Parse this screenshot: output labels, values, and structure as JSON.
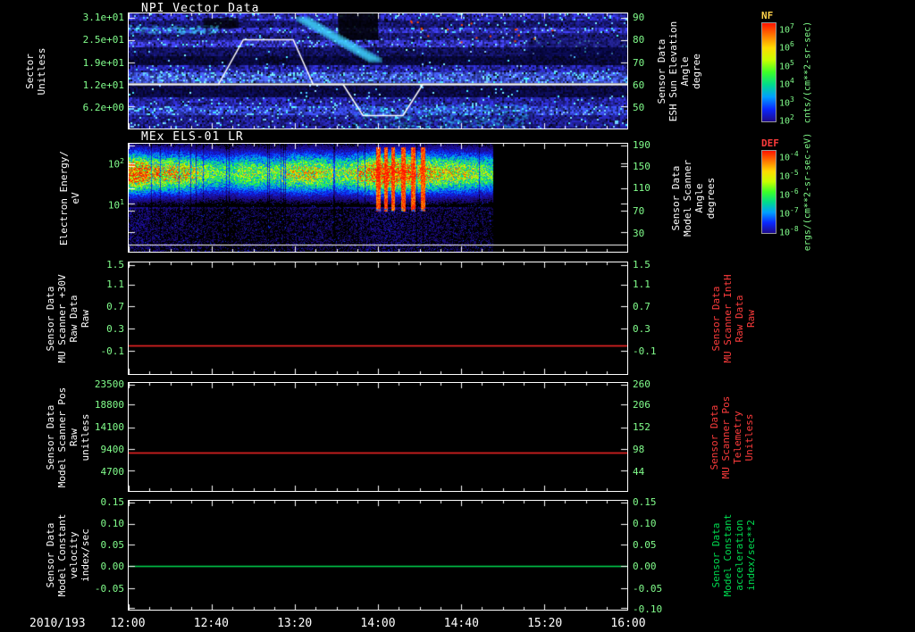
{
  "colors": {
    "background": "#000000",
    "tick_label": "#82ff8c",
    "axis": "#ffffff",
    "red_series": "#ff2828",
    "green_series": "#00dc50"
  },
  "xaxis": {
    "date_label": "2010/193",
    "ticks": [
      "12:00",
      "12:40",
      "13:20",
      "14:00",
      "14:40",
      "15:20",
      "16:00"
    ]
  },
  "chart_data": [
    {
      "type": "heatmap",
      "title": "NPI Vector Data",
      "ylabel_lines": [
        "Sector",
        "Unitless"
      ],
      "yticks": [
        {
          "label": "3.1e+01",
          "f": 0.035
        },
        {
          "label": "2.5e+01",
          "f": 0.23
        },
        {
          "label": "1.9e+01",
          "f": 0.425
        },
        {
          "label": "1.2e+01",
          "f": 0.615
        },
        {
          "label": "6.2e+00",
          "f": 0.81
        }
      ],
      "y2label_lines": [
        "Sensor Data",
        "ESH Sun Elevation",
        "Angle",
        "degree"
      ],
      "y2label_color": "#ffffff",
      "y2ticks": [
        {
          "label": "90",
          "f": 0.035
        },
        {
          "label": "80",
          "f": 0.23
        },
        {
          "label": "70",
          "f": 0.425
        },
        {
          "label": "60",
          "f": 0.615
        },
        {
          "label": "50",
          "f": 0.81
        }
      ],
      "overlay_line": {
        "name": "ESH Sun Elevation Angle",
        "units": "degrees",
        "color": "#ffffff",
        "baseline_deg": 60,
        "points_frac_deg": [
          [
            0,
            60
          ],
          [
            0.18,
            60
          ],
          [
            0.23,
            80
          ],
          [
            0.33,
            80
          ],
          [
            0.37,
            60
          ],
          [
            0.43,
            60
          ],
          [
            0.47,
            46
          ],
          [
            0.55,
            46
          ],
          [
            0.59,
            60
          ],
          [
            1,
            60
          ]
        ],
        "deg_top": 90,
        "f_top": 0.035,
        "deg_bot": 50,
        "f_bot": 0.81
      },
      "colorbar": {
        "title": "NF",
        "title_color": "#ffd24a",
        "units": "cnts/(cm**2-sr-sec)",
        "ticks": [
          "10^7",
          "10^6",
          "10^5",
          "10^4",
          "10^3",
          "10^2"
        ]
      },
      "bands": [
        {
          "f0": 0.0,
          "f1": 0.06,
          "base": [
            40,
            40,
            170
          ],
          "bright": 0.06
        },
        {
          "f0": 0.06,
          "f1": 0.12,
          "base": [
            22,
            22,
            110
          ],
          "bright": 0.02
        },
        {
          "f0": 0.12,
          "f1": 0.17,
          "base": [
            48,
            48,
            190
          ],
          "bright": 0.1
        },
        {
          "f0": 0.17,
          "f1": 0.23,
          "base": [
            26,
            26,
            120
          ],
          "bright": 0.03
        },
        {
          "f0": 0.23,
          "f1": 0.29,
          "base": [
            52,
            52,
            195
          ],
          "bright": 0.08
        },
        {
          "f0": 0.29,
          "f1": 0.37,
          "base": [
            18,
            18,
            95
          ],
          "bright": 0.02
        },
        {
          "f0": 0.37,
          "f1": 0.44,
          "base": [
            8,
            8,
            60
          ],
          "bright": 0.01
        },
        {
          "f0": 0.44,
          "f1": 0.5,
          "base": [
            36,
            36,
            160
          ],
          "bright": 0.05
        },
        {
          "f0": 0.5,
          "f1": 0.6,
          "base": [
            60,
            80,
            215
          ],
          "bright": 0.15
        },
        {
          "f0": 0.62,
          "f1": 0.72,
          "base": [
            10,
            10,
            70
          ],
          "bright": 0.02
        },
        {
          "f0": 0.72,
          "f1": 0.8,
          "base": [
            36,
            36,
            160
          ],
          "bright": 0.05
        },
        {
          "f0": 0.8,
          "f1": 0.88,
          "base": [
            48,
            62,
            200
          ],
          "bright": 0.12
        },
        {
          "f0": 0.88,
          "f1": 1.0,
          "base": [
            30,
            30,
            140
          ],
          "bright": 0.05
        }
      ],
      "features": [
        {
          "type": "rect",
          "x0": 0.42,
          "x1": 0.5,
          "f0": 0.0,
          "f1": 0.23,
          "color": "#000000",
          "alpha": 0.85
        },
        {
          "type": "rect",
          "x0": 0.15,
          "x1": 0.22,
          "f0": 0.04,
          "f1": 0.13,
          "color": "#000000",
          "alpha": 0.75
        },
        {
          "type": "rect",
          "x0": 0.8,
          "x1": 1.0,
          "f0": 0.23,
          "f1": 0.37,
          "color": "#000030",
          "alpha": 0.5
        },
        {
          "type": "streak",
          "x0": 0.35,
          "y0": 0.05,
          "x1": 0.5,
          "y1": 0.42,
          "color": "#40d8ff",
          "alpha": 0.45
        },
        {
          "type": "glow",
          "x0": 0.45,
          "x1": 0.8,
          "f0": 0.78,
          "f1": 0.99,
          "color": "#30d8ff",
          "alpha": 0.55,
          "count": 420
        },
        {
          "type": "glow",
          "x0": 0.0,
          "x1": 0.18,
          "f0": 0.1,
          "f1": 0.17,
          "color": "#40e0ff",
          "alpha": 0.55,
          "count": 160
        },
        {
          "type": "speckle",
          "x0": 0.55,
          "x1": 0.95,
          "f0": 0.06,
          "f1": 0.26,
          "color": "#ff4600",
          "count": 18
        },
        {
          "type": "speckle",
          "x0": 0.05,
          "x1": 0.4,
          "f0": 0.5,
          "f1": 0.6,
          "color": "#80ffff",
          "count": 30
        }
      ]
    },
    {
      "type": "heatmap",
      "title": "MEx ELS-01 LR",
      "ylabel_lines": [
        "Electron Energy/",
        "eV"
      ],
      "yticks": [
        {
          "label": "10^2",
          "f": 0.18
        },
        {
          "label": "10^1",
          "f": 0.553
        }
      ],
      "y2label_lines": [
        "Sensor Data",
        "Model Scanner",
        "Angle",
        "degrees"
      ],
      "y2label_color": "#ffffff",
      "y2ticks": [
        {
          "label": "190",
          "f": 0.02
        },
        {
          "label": "150",
          "f": 0.21
        },
        {
          "label": "110",
          "f": 0.41
        },
        {
          "label": "70",
          "f": 0.62
        },
        {
          "label": "30",
          "f": 0.82
        }
      ],
      "colorbar": {
        "title": "DEF",
        "title_color": "#ff3c3c",
        "units": "ergs/(cm**2-sr-sec-eV)",
        "ticks": [
          "10^-4",
          "10^-5",
          "10^-6",
          "10^-7",
          "10^-8"
        ]
      },
      "t_end": 0.73,
      "band_center": 0.27,
      "band_width": 0.17,
      "intensity": [
        1,
        0.95,
        0.8,
        0.75,
        0.78,
        0.72,
        0.6,
        0.55,
        0.5,
        0.6,
        0.62,
        0.55,
        0.6,
        0.7,
        0.72,
        0.7,
        0.65,
        0.6,
        0.68,
        0.85,
        0.95,
        1,
        0.95,
        0.85,
        0.78,
        0.72,
        0.7,
        0.66,
        0.6,
        0.55
      ],
      "red_streaks": [
        0.5,
        0.515,
        0.53,
        0.55,
        0.57,
        0.59
      ],
      "bottom_line_f": 0.93
    },
    {
      "type": "line",
      "title": "",
      "ylabel_lines": [
        "Sensor Data",
        "MU Scanner +30V",
        "Raw Data",
        "Raw"
      ],
      "yticks": [
        {
          "label": "1.5",
          "f": 0.02
        },
        {
          "label": "1.1",
          "f": 0.2
        },
        {
          "label": "0.7",
          "f": 0.39
        },
        {
          "label": "0.3",
          "f": 0.59
        },
        {
          "label": "-0.1",
          "f": 0.79
        }
      ],
      "y2label_lines": [
        "Sensor Data",
        "MU Scanner IntH",
        "Raw Data",
        "Raw"
      ],
      "y2label_color": "#ff3c3c",
      "y2ticks": [
        {
          "label": "1.5",
          "f": 0.02
        },
        {
          "label": "1.1",
          "f": 0.2
        },
        {
          "label": "0.7",
          "f": 0.39
        },
        {
          "label": "0.3",
          "f": 0.59
        },
        {
          "label": "-0.1",
          "f": 0.79
        }
      ],
      "series": [
        {
          "name": "MU Scanner +30V Raw Data",
          "color": "#ff2828",
          "value": 0.0,
          "f": 0.74
        }
      ]
    },
    {
      "type": "line",
      "title": "",
      "ylabel_lines": [
        "Sensor Data",
        "Model Scanner Pos",
        "Raw",
        "unitless"
      ],
      "yticks": [
        {
          "label": "23500",
          "f": 0.02
        },
        {
          "label": "18800",
          "f": 0.2
        },
        {
          "label": "14100",
          "f": 0.41
        },
        {
          "label": "9400",
          "f": 0.61
        },
        {
          "label": "4700",
          "f": 0.81
        }
      ],
      "y2label_lines": [
        "Sensor Data",
        "MU Scanner Pos",
        "Telemetry",
        "Unitless"
      ],
      "y2label_color": "#ff3c3c",
      "y2ticks": [
        {
          "label": "260",
          "f": 0.02
        },
        {
          "label": "206",
          "f": 0.2
        },
        {
          "label": "152",
          "f": 0.41
        },
        {
          "label": "98",
          "f": 0.61
        },
        {
          "label": "44",
          "f": 0.81
        }
      ],
      "series": [
        {
          "name": "Model Scanner Pos Raw",
          "color": "#ff2828",
          "value": 8800,
          "f": 0.645
        }
      ]
    },
    {
      "type": "line",
      "title": "",
      "ylabel_lines": [
        "Sensor Data",
        "Model Constant",
        "velocity",
        "index/sec"
      ],
      "yticks": [
        {
          "label": "0.15",
          "f": 0.02
        },
        {
          "label": "0.10",
          "f": 0.21
        },
        {
          "label": "0.05",
          "f": 0.4
        },
        {
          "label": "0.00",
          "f": 0.6
        },
        {
          "label": "-0.05",
          "f": 0.8
        }
      ],
      "y2label_lines": [
        "Sensor Data",
        "Model Constant",
        "acceleration",
        "index/sec**2"
      ],
      "y2label_color": "#00dc50",
      "y2ticks": [
        {
          "label": "0.15",
          "f": 0.02
        },
        {
          "label": "0.10",
          "f": 0.21
        },
        {
          "label": "0.05",
          "f": 0.4
        },
        {
          "label": "0.00",
          "f": 0.6
        },
        {
          "label": "-0.05",
          "f": 0.8
        },
        {
          "label": "-0.10",
          "f": 0.985
        }
      ],
      "series": [
        {
          "name": "Model Constant velocity",
          "color": "#00dc50",
          "value": 0.0,
          "f": 0.6
        }
      ]
    }
  ]
}
